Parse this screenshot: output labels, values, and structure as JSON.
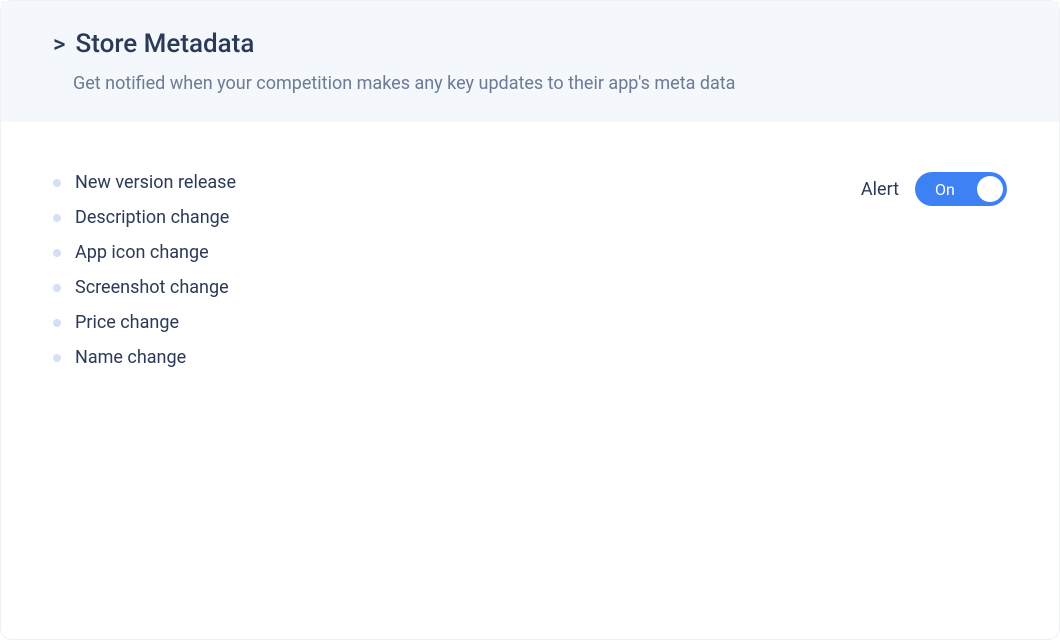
{
  "header": {
    "chevron": ">",
    "title": "Store Metadata",
    "subtitle": "Get notified when your competition makes any key updates to their app's meta data"
  },
  "list": {
    "items": [
      "New version release",
      "Description change",
      "App icon change",
      "Screenshot change",
      "Price change",
      "Name change"
    ]
  },
  "alert": {
    "label": "Alert",
    "toggle_text": "On",
    "enabled": true
  }
}
